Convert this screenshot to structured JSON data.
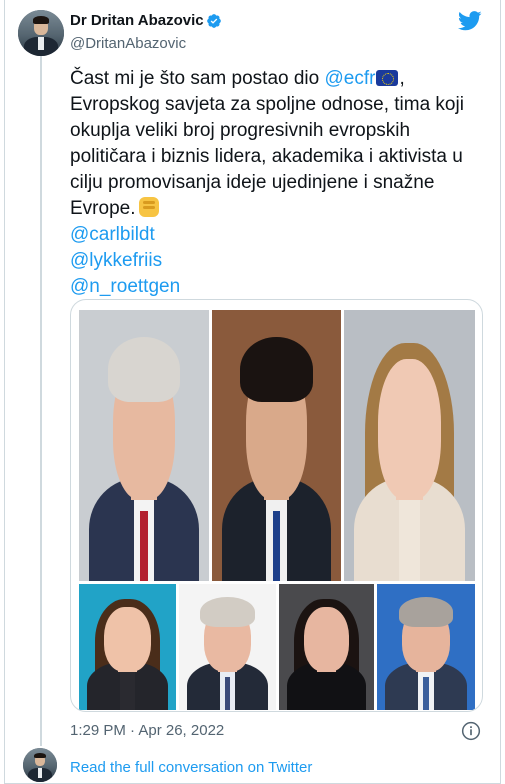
{
  "author": {
    "name": "Dr Dritan Abazovic",
    "handle": "@DritanAbazovic",
    "verified": true
  },
  "tweet": {
    "text_lines": [
      "Evropskog savjeta za spoljne odnose, tima koji",
      "okuplja veliki broj progresivnih evropskih",
      "političara i biznis lidera, akademika i aktivista u",
      "cilju promovisanja ideje ujedinjene i snažne"
    ],
    "line1_prefix": "Čast mi je što sam postao dio ",
    "line1_mention": "@ecfr",
    "line1_suffix": ",",
    "last_line": "Evrope.",
    "mentions": [
      "@carlbildt",
      "@lykkefriis",
      "@n_roettgen"
    ],
    "emoji": [
      "eu-flag-icon",
      "raised-fist-icon"
    ]
  },
  "media": {
    "photos": [
      {
        "name": "portrait-1",
        "bg": "#c9cdd1",
        "skin": "#e7b9a0",
        "hair": "#d8d5d0",
        "suit": "#2b3550",
        "shirt": "#f3f3f3",
        "tie": "#b3202f"
      },
      {
        "name": "portrait-2",
        "bg": "#8a5a3c",
        "skin": "#d9a98a",
        "hair": "#1a1311",
        "suit": "#1c222c",
        "shirt": "#f0f0f0",
        "tie": "#1d3f8a"
      },
      {
        "name": "portrait-3",
        "bg": "#b9bec4",
        "skin": "#f0c9b4",
        "hair": "#a37a45",
        "suit": "#e8ddd0",
        "shirt": "#efe6da",
        "tie": null
      },
      {
        "name": "portrait-4",
        "bg": "#21a3c7",
        "skin": "#efc2a8",
        "hair": "#4a2d1a",
        "suit": "#24252b",
        "shirt": "#2a2a30",
        "tie": null
      },
      {
        "name": "portrait-5",
        "bg": "#f4f4f4",
        "skin": "#e9b9a2",
        "hair": "#d2ccc4",
        "suit": "#232a38",
        "shirt": "#e8ecf4",
        "tie": "#3a4a7a"
      },
      {
        "name": "portrait-6",
        "bg": "#4a4a4d",
        "skin": "#e7b6a0",
        "hair": "#1b1311",
        "suit": "#111114",
        "shirt": "#111114",
        "tie": null
      },
      {
        "name": "portrait-7",
        "bg": "#2f6fc4",
        "skin": "#e6b49c",
        "hair": "#a8a29c",
        "suit": "#2e3a52",
        "shirt": "#f0f2f5",
        "tie": "#3b5f9c"
      }
    ]
  },
  "meta": {
    "timestamp": "1:29 PM · Apr 26, 2022",
    "read_more": "Read the full conversation on Twitter"
  },
  "colors": {
    "accent": "#1d9bf0",
    "secondary_text": "#536471",
    "border": "#cfd9de"
  }
}
